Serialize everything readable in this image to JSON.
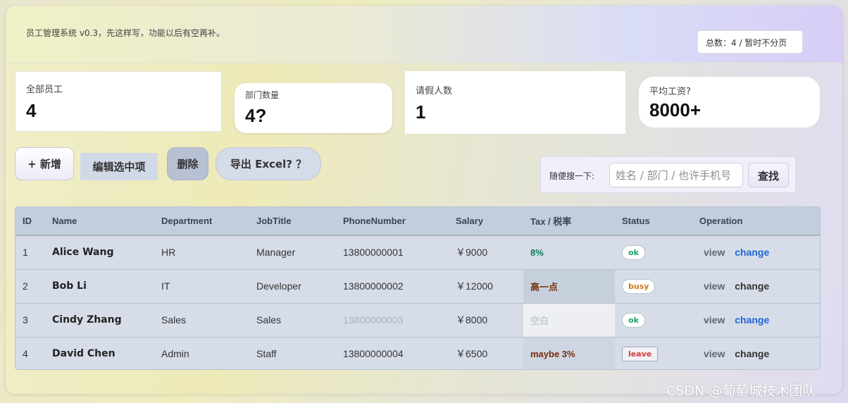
{
  "header": {
    "title": "员工管理系统 v0.3，先这样写，功能以后有空再补。",
    "total": "总数：4 / 暂时不分页"
  },
  "stats": [
    {
      "label": "全部员工",
      "value": "4"
    },
    {
      "label": "部门数量",
      "value": "4?"
    },
    {
      "label": "请假人数",
      "value": "1"
    },
    {
      "label": "平均工资?",
      "value": "8000+"
    }
  ],
  "toolbar": {
    "add_label": "+ 新增",
    "edit_label": "编辑选中项",
    "delete_label": "删除",
    "export_label": "导出 Excel? ？"
  },
  "search": {
    "label": "随便搜一下:",
    "placeholder": "姓名 / 部门 / 也许手机号",
    "button_label": "查找"
  },
  "table": {
    "columns": [
      "ID",
      "Name",
      "Department",
      "JobTitle",
      "PhoneNumber",
      "Salary",
      "Tax / 税率",
      "Status",
      "Operation"
    ],
    "rows": [
      {
        "id": "1",
        "name": "Alice Wang",
        "department": "HR",
        "job": "Manager",
        "phone": "13800000001",
        "salary": "￥9000",
        "tax": "8%",
        "status": "ok",
        "view": "view",
        "change": "change"
      },
      {
        "id": "2",
        "name": "Bob Li",
        "department": "IT",
        "job": "Developer",
        "phone": "13800000002",
        "salary": "￥12000",
        "tax": "高一点",
        "status": "busy",
        "view": "view",
        "change": "change"
      },
      {
        "id": "3",
        "name": "Cindy Zhang",
        "department": "Sales",
        "job": "Sales",
        "phone": "13800000003",
        "salary": "￥8000",
        "tax": "空白",
        "status": "ok",
        "view": "view",
        "change": "change"
      },
      {
        "id": "4",
        "name": "David Chen",
        "department": "Admin",
        "job": "Staff",
        "phone": "13800000004",
        "salary": "￥6500",
        "tax": "maybe 3%",
        "status": "leave",
        "view": "view",
        "change": "change"
      }
    ]
  },
  "watermark": "CSDN @葡萄城技术团队",
  "colors": {
    "link_blue": "#2065d8",
    "status_ok": "#19a163",
    "status_busy": "#cc7a14",
    "status_leave": "#d53a3a"
  }
}
